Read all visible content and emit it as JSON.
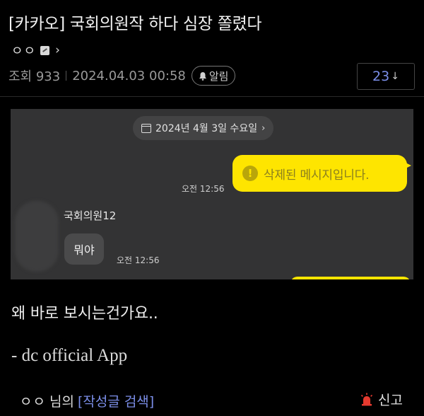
{
  "post": {
    "title": "[카카오] 국회의원작 하다 심장 쫄렸다",
    "author": "ㅇㅇ",
    "views_label": "조회 933",
    "datetime": "2024.04.03 00:58",
    "alarm_label": "알림",
    "comment_count": "23",
    "body_text": "왜 바로 보시는건가요..",
    "app_signature": "- dc official App"
  },
  "chat_image": {
    "date_chip": "2024년 4월 3일 수요일",
    "deleted_message": "삭제된 메시지입니다.",
    "time_sent": "오전 12:56",
    "sender_name": "국회의원12",
    "reply_message": "뭐야",
    "time_reply": "오전 12:56",
    "colors": {
      "my_bubble": "#fee500",
      "background": "#333334"
    }
  },
  "footer": {
    "author": "ㅇㅇ",
    "suffix": "님의",
    "search_link": "[작성글 검색]",
    "report_label": "신고"
  },
  "icons": [
    "fixed-icon",
    "chevron-right-icon",
    "bell-icon",
    "down-arrow-icon",
    "calendar-icon",
    "warning-icon",
    "siren-icon"
  ],
  "colors": {
    "link": "#7b8ee8",
    "background": "#000000"
  }
}
